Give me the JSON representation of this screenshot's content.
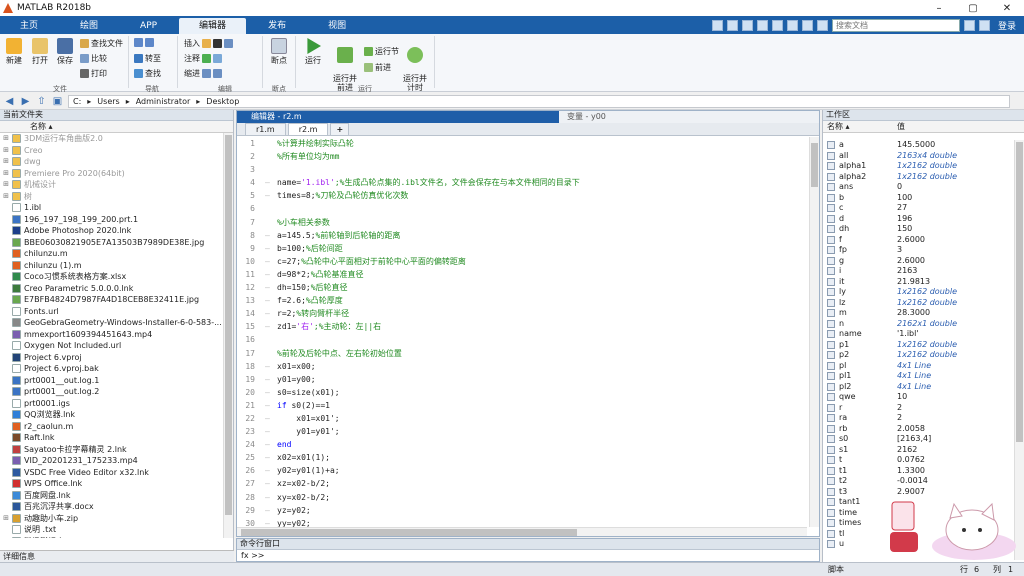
{
  "window": {
    "title": "MATLAB R2018b",
    "minimize": "–",
    "maximize": "▢",
    "close": "✕"
  },
  "tabs": [
    "主页",
    "绘图",
    "APP",
    "编辑器",
    "发布",
    "视图"
  ],
  "search_placeholder": "搜索文档",
  "login": "登录",
  "ribbon": {
    "new": "新建",
    "open": "打开",
    "save": "保存",
    "find_files": "查找文件",
    "compare": "比较",
    "print": "打印",
    "goto": "转至",
    "find": "查找",
    "insert": "插入",
    "comment": "注释",
    "indent": "缩进",
    "breakpoints": "断点",
    "run": "运行",
    "run_advance": "运行并\n前进",
    "run_section": "运行节",
    "advance": "前进",
    "run_time": "运行并\n计时",
    "groups": [
      "文件",
      "导航",
      "编辑",
      "断点",
      "运行"
    ]
  },
  "address": {
    "path": [
      "C:",
      "Users",
      "Administrator",
      "Desktop"
    ]
  },
  "current_folder": {
    "title": "当前文件夹",
    "col_name": "名称 ▴",
    "items": [
      {
        "name": "3DM运行车角曲版2.0",
        "dim": true,
        "ex": "⊞",
        "c": "#f0c14b"
      },
      {
        "name": "Creo",
        "dim": true,
        "ex": "⊞",
        "c": "#f0c14b"
      },
      {
        "name": "dwg",
        "dim": true,
        "ex": "⊞",
        "c": "#f0c14b"
      },
      {
        "name": "Premiere Pro 2020(64bit)",
        "dim": true,
        "ex": "⊞",
        "c": "#f0c14b"
      },
      {
        "name": "机械设计",
        "dim": true,
        "ex": "⊞",
        "c": "#f0c14b"
      },
      {
        "name": "树",
        "dim": true,
        "ex": "⊞",
        "c": "#f0c14b"
      },
      {
        "name": "1.ibl",
        "dim": false,
        "ex": "",
        "c": "#ffffff"
      },
      {
        "name": "196_197_198_199_200.prt.1",
        "dim": false,
        "ex": "",
        "c": "#3b74c4"
      },
      {
        "name": "Adobe Photoshop 2020.lnk",
        "dim": false,
        "ex": "",
        "c": "#1c3f8a"
      },
      {
        "name": "BBE06030821905E7A13503B7989DE38E.jpg",
        "dim": false,
        "ex": "",
        "c": "#6aa84f"
      },
      {
        "name": "chilunzu.m",
        "dim": false,
        "ex": "",
        "c": "#e06020"
      },
      {
        "name": "chilunzu (1).m",
        "dim": false,
        "ex": "",
        "c": "#e06020"
      },
      {
        "name": "Coco习惯系统表格方案.xlsx",
        "dim": false,
        "ex": "",
        "c": "#2f8a4c"
      },
      {
        "name": "Creo Parametric 5.0.0.0.lnk",
        "dim": false,
        "ex": "",
        "c": "#3d7a3d"
      },
      {
        "name": "E7BFB4824D7987FA4D18CEB8E32411E.jpg",
        "dim": false,
        "ex": "",
        "c": "#6aa84f"
      },
      {
        "name": "Fonts.url",
        "dim": false,
        "ex": "",
        "c": "#ffffff"
      },
      {
        "name": "GeoGebraGeometry-Windows-Installer-6-0-583-...",
        "dim": false,
        "ex": "",
        "c": "#888888"
      },
      {
        "name": "mmexport1609394451643.mp4",
        "dim": false,
        "ex": "",
        "c": "#7a5fb0"
      },
      {
        "name": "Oxygen Not Included.url",
        "dim": false,
        "ex": "",
        "c": "#ffffff"
      },
      {
        "name": "Project 6.vproj",
        "dim": false,
        "ex": "",
        "c": "#224477"
      },
      {
        "name": "Project 6.vproj.bak",
        "dim": false,
        "ex": "",
        "c": "#ffffff"
      },
      {
        "name": "prt0001__out.log.1",
        "dim": false,
        "ex": "",
        "c": "#3b74c4"
      },
      {
        "name": "prt0001__out.log.2",
        "dim": false,
        "ex": "",
        "c": "#3b74c4"
      },
      {
        "name": "prt0001.igs",
        "dim": false,
        "ex": "",
        "c": "#ffffff"
      },
      {
        "name": "QQ浏览器.lnk",
        "dim": false,
        "ex": "",
        "c": "#2f7fd8"
      },
      {
        "name": "r2_caolun.m",
        "dim": false,
        "ex": "",
        "c": "#e06020"
      },
      {
        "name": "Raft.lnk",
        "dim": false,
        "ex": "",
        "c": "#7a4a2a"
      },
      {
        "name": "Sayatoo卡拉字幕精灵 2.lnk",
        "dim": false,
        "ex": "",
        "c": "#c04040"
      },
      {
        "name": "VID_20201231_175233.mp4",
        "dim": false,
        "ex": "",
        "c": "#7a5fb0"
      },
      {
        "name": "VSDC Free Video Editor x32.lnk",
        "dim": false,
        "ex": "",
        "c": "#2d5aa0"
      },
      {
        "name": "WPS Office.lnk",
        "dim": false,
        "ex": "",
        "c": "#d03030"
      },
      {
        "name": "百度网盘.lnk",
        "dim": false,
        "ex": "",
        "c": "#3b8ad8"
      },
      {
        "name": "百兆沉浮共享.docx",
        "dim": false,
        "ex": "",
        "c": "#2b579a"
      },
      {
        "name": "动趣助小车.zip",
        "dim": false,
        "ex": "⊞",
        "c": "#d8a030"
      },
      {
        "name": "说明 .txt",
        "dim": false,
        "ex": "",
        "c": "#ffffff"
      },
      {
        "name": "腾讯影视库.lnk",
        "dim": false,
        "ex": "",
        "c": "#e08020"
      }
    ],
    "details": "详细信息"
  },
  "editor": {
    "title": "编辑器 - r2.m",
    "variables": "变量 - y00",
    "file_tabs": [
      "r1.m",
      "r2.m",
      "+"
    ],
    "lines": [
      {
        "n": "1",
        "d": "",
        "t": [
          {
            "c": "cm",
            "v": "%计算并绘制实际凸轮"
          }
        ]
      },
      {
        "n": "2",
        "d": "",
        "t": [
          {
            "c": "cm",
            "v": "%所有单位均为mm"
          }
        ]
      },
      {
        "n": "3",
        "d": "",
        "t": []
      },
      {
        "n": "4",
        "d": "–",
        "t": [
          {
            "c": "",
            "v": "name="
          },
          {
            "c": "st",
            "v": "'1.ibl'"
          },
          {
            "c": "cm",
            "v": ";%生成凸轮点集的.ibl文件名，文件会保存在与本文件相同的目录下"
          }
        ]
      },
      {
        "n": "5",
        "d": "–",
        "t": [
          {
            "c": "",
            "v": "times=8;"
          },
          {
            "c": "cm",
            "v": "%刀轮及凸轮仿真优化次数"
          }
        ]
      },
      {
        "n": "6",
        "d": "",
        "t": []
      },
      {
        "n": "7",
        "d": "",
        "t": [
          {
            "c": "cm",
            "v": "%小车相关参数"
          }
        ]
      },
      {
        "n": "8",
        "d": "–",
        "t": [
          {
            "c": "",
            "v": "a=145.5;"
          },
          {
            "c": "cm",
            "v": "%前轮轴到后轮轴的距离"
          }
        ]
      },
      {
        "n": "9",
        "d": "–",
        "t": [
          {
            "c": "",
            "v": "b=100;"
          },
          {
            "c": "cm",
            "v": "%后轮间距"
          }
        ]
      },
      {
        "n": "10",
        "d": "–",
        "t": [
          {
            "c": "",
            "v": "c=27;"
          },
          {
            "c": "cm",
            "v": "%凸轮中心平面相对于前轮中心平面的偏转距离"
          }
        ]
      },
      {
        "n": "11",
        "d": "–",
        "t": [
          {
            "c": "",
            "v": "d=98*2;"
          },
          {
            "c": "cm",
            "v": "%凸轮基准直径"
          }
        ]
      },
      {
        "n": "12",
        "d": "–",
        "t": [
          {
            "c": "",
            "v": "dh=150;"
          },
          {
            "c": "cm",
            "v": "%后轮直径"
          }
        ]
      },
      {
        "n": "13",
        "d": "–",
        "t": [
          {
            "c": "",
            "v": "f=2.6;"
          },
          {
            "c": "cm",
            "v": "%凸轮厚度"
          }
        ]
      },
      {
        "n": "14",
        "d": "–",
        "t": [
          {
            "c": "",
            "v": "r=2;"
          },
          {
            "c": "cm",
            "v": "%转向臂杆半径"
          }
        ]
      },
      {
        "n": "15",
        "d": "–",
        "t": [
          {
            "c": "",
            "v": "zd1="
          },
          {
            "c": "st",
            "v": "'右'"
          },
          {
            "c": "cm",
            "v": ";%主动轮：左||右"
          }
        ]
      },
      {
        "n": "16",
        "d": "",
        "t": []
      },
      {
        "n": "17",
        "d": "",
        "t": [
          {
            "c": "cm",
            "v": "%前轮及后轮中点、左右轮初始位置"
          }
        ]
      },
      {
        "n": "18",
        "d": "–",
        "t": [
          {
            "c": "",
            "v": "x01=x00;"
          }
        ]
      },
      {
        "n": "19",
        "d": "–",
        "t": [
          {
            "c": "",
            "v": "y01=y00;"
          }
        ]
      },
      {
        "n": "20",
        "d": "–",
        "t": [
          {
            "c": "",
            "v": "s0=size(x01);"
          }
        ]
      },
      {
        "n": "21",
        "d": "–",
        "t": [
          {
            "c": "kw",
            "v": "if"
          },
          {
            "c": "",
            "v": " s0(2)==1"
          }
        ]
      },
      {
        "n": "22",
        "d": "–",
        "t": [
          {
            "c": "",
            "v": "    x01=x01';"
          }
        ]
      },
      {
        "n": "23",
        "d": "–",
        "t": [
          {
            "c": "",
            "v": "    y01=y01';"
          }
        ]
      },
      {
        "n": "24",
        "d": "–",
        "t": [
          {
            "c": "kw",
            "v": "end"
          }
        ]
      },
      {
        "n": "25",
        "d": "–",
        "t": [
          {
            "c": "",
            "v": "x02=x01(1);"
          }
        ]
      },
      {
        "n": "26",
        "d": "–",
        "t": [
          {
            "c": "",
            "v": "y02=y01(1)+a;"
          }
        ]
      },
      {
        "n": "27",
        "d": "–",
        "t": [
          {
            "c": "",
            "v": "xz=x02-b/2;"
          }
        ]
      },
      {
        "n": "28",
        "d": "–",
        "t": [
          {
            "c": "",
            "v": "xy=x02-b/2;"
          }
        ]
      },
      {
        "n": "29",
        "d": "–",
        "t": [
          {
            "c": "",
            "v": "yz=y02;"
          }
        ]
      },
      {
        "n": "30",
        "d": "–",
        "t": [
          {
            "c": "",
            "v": "yy=y02;"
          }
        ]
      }
    ]
  },
  "command_window": {
    "title": "命令行窗口",
    "prompt": "fx >>"
  },
  "workspace": {
    "title": "工作区",
    "col_name": "名称 ▴",
    "col_value": "值",
    "vars": [
      {
        "n": "a",
        "v": "145.5000",
        "i": false
      },
      {
        "n": "all",
        "v": "2163x4 double",
        "i": true
      },
      {
        "n": "alpha1",
        "v": "1x2162 double",
        "i": true
      },
      {
        "n": "alpha2",
        "v": "1x2162 double",
        "i": true
      },
      {
        "n": "ans",
        "v": "0",
        "i": false
      },
      {
        "n": "b",
        "v": "100",
        "i": false
      },
      {
        "n": "c",
        "v": "27",
        "i": false
      },
      {
        "n": "d",
        "v": "196",
        "i": false
      },
      {
        "n": "dh",
        "v": "150",
        "i": false
      },
      {
        "n": "f",
        "v": "2.6000",
        "i": false
      },
      {
        "n": "fp",
        "v": "3",
        "i": false
      },
      {
        "n": "g",
        "v": "2.6000",
        "i": false
      },
      {
        "n": "i",
        "v": "2163",
        "i": false
      },
      {
        "n": "it",
        "v": "21.9813",
        "i": false
      },
      {
        "n": "ly",
        "v": "1x2162 double",
        "i": true
      },
      {
        "n": "lz",
        "v": "1x2162 double",
        "i": true
      },
      {
        "n": "m",
        "v": "28.3000",
        "i": false
      },
      {
        "n": "n",
        "v": "2162x1 double",
        "i": true
      },
      {
        "n": "name",
        "v": "'1.ibl'",
        "i": false
      },
      {
        "n": "p1",
        "v": "1x2162 double",
        "i": true
      },
      {
        "n": "p2",
        "v": "1x2162 double",
        "i": true
      },
      {
        "n": "pl",
        "v": "4x1 Line",
        "i": true
      },
      {
        "n": "pl1",
        "v": "4x1 Line",
        "i": true
      },
      {
        "n": "pl2",
        "v": "4x1 Line",
        "i": true
      },
      {
        "n": "qwe",
        "v": "10",
        "i": false
      },
      {
        "n": "r",
        "v": "2",
        "i": false
      },
      {
        "n": "ra",
        "v": "2",
        "i": false
      },
      {
        "n": "rb",
        "v": "2.0058",
        "i": false
      },
      {
        "n": "s0",
        "v": "[2163,4]",
        "i": false
      },
      {
        "n": "s1",
        "v": "2162",
        "i": false
      },
      {
        "n": "t",
        "v": "0.0762",
        "i": false
      },
      {
        "n": "t1",
        "v": "1.3300",
        "i": false
      },
      {
        "n": "t2",
        "v": "-0.0014",
        "i": false
      },
      {
        "n": "t3",
        "v": "2.9007",
        "i": false
      },
      {
        "n": "tant1",
        "v": "",
        "i": false
      },
      {
        "n": "time",
        "v": "10",
        "i": false
      },
      {
        "n": "times",
        "v": "",
        "i": false
      },
      {
        "n": "tl",
        "v": "",
        "i": false
      },
      {
        "n": "u",
        "v": "",
        "i": false
      }
    ]
  },
  "status": {
    "mode": "脚本",
    "row_label": "行",
    "row": "6",
    "col_label": "列",
    "col": "1"
  },
  "colors": {
    "title_blue": "#1c5fa8",
    "run_green": "#3a9a3a"
  }
}
